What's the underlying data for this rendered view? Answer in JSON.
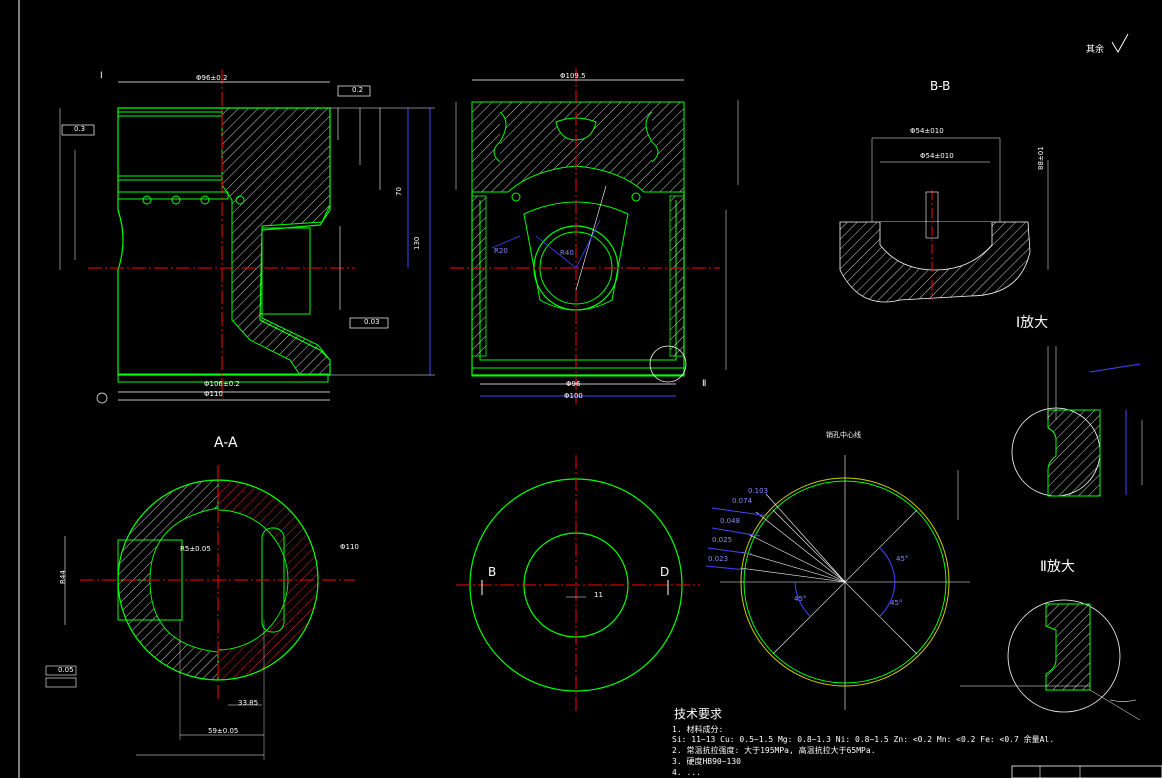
{
  "colors": {
    "background": "#000000",
    "outline": "#00ff00",
    "dimension": "#ffffff",
    "centerline": "#ff0000",
    "blue_dim": "#2222ff",
    "yellow_hatch": "#cccc00"
  },
  "top_right": {
    "roughness_label": "其余"
  },
  "sections": {
    "bb_title": "B-B",
    "aa_title": "A-A",
    "detail1_title": "Ⅰ放大",
    "detail2_title": "Ⅱ放大",
    "pin_center_label": "销孔中心线"
  },
  "labels": {
    "marker_I": "Ⅰ",
    "marker_II": "Ⅱ",
    "section_b": "B",
    "section_d": "D",
    "dim_left_top": "Φ96±0.2",
    "dim_mid_top": "Φ109.5",
    "dim_left_bottom1": "Φ106±0.2",
    "dim_left_bottom2": "Φ110",
    "dim_mid_bottom1": "Φ96",
    "dim_mid_bottom2": "Φ100",
    "dim_bb_1": "Φ54±010",
    "dim_bb_2": "Φ54±010",
    "dim_bb_3": "88±01",
    "dim_height_1": "130",
    "dim_height_2": "70",
    "dim_aa_bottom1": "33.85",
    "dim_aa_bottom2": "59±0.05",
    "dim_aa_left": "R44",
    "dim_aa_mid": "R5±0.05",
    "dim_aa_right": "Φ110",
    "dim_circle_4": "11",
    "dim_r_small": "R20",
    "dim_r_mid": "R40",
    "tol_1": "0.2",
    "tol_2": "0.3",
    "tol_3": "0.03",
    "tol_4": "0.05",
    "radial_1": "0.103",
    "radial_2": "0.074",
    "radial_3": "0.048",
    "radial_4": "0.025",
    "radial_5": "0.023",
    "angle_1": "45°",
    "angle_2": "45°",
    "angle_3": "45°"
  },
  "tech_notes": {
    "title": "技术要求",
    "lines": [
      "1. 材料成分:",
      "   Si: 11~13  Cu: 0.5~1.5  Mg: 0.8~1.3  Ni: 0.8~1.5 Zn: <0.2  Mn: <0.2  Fe: <0.7  余量Al.",
      "2. 常温抗拉强度: 大于195MPa, 高温抗拉大于65MPa.",
      "3. 硬度HB90~130",
      "4. ..."
    ]
  }
}
